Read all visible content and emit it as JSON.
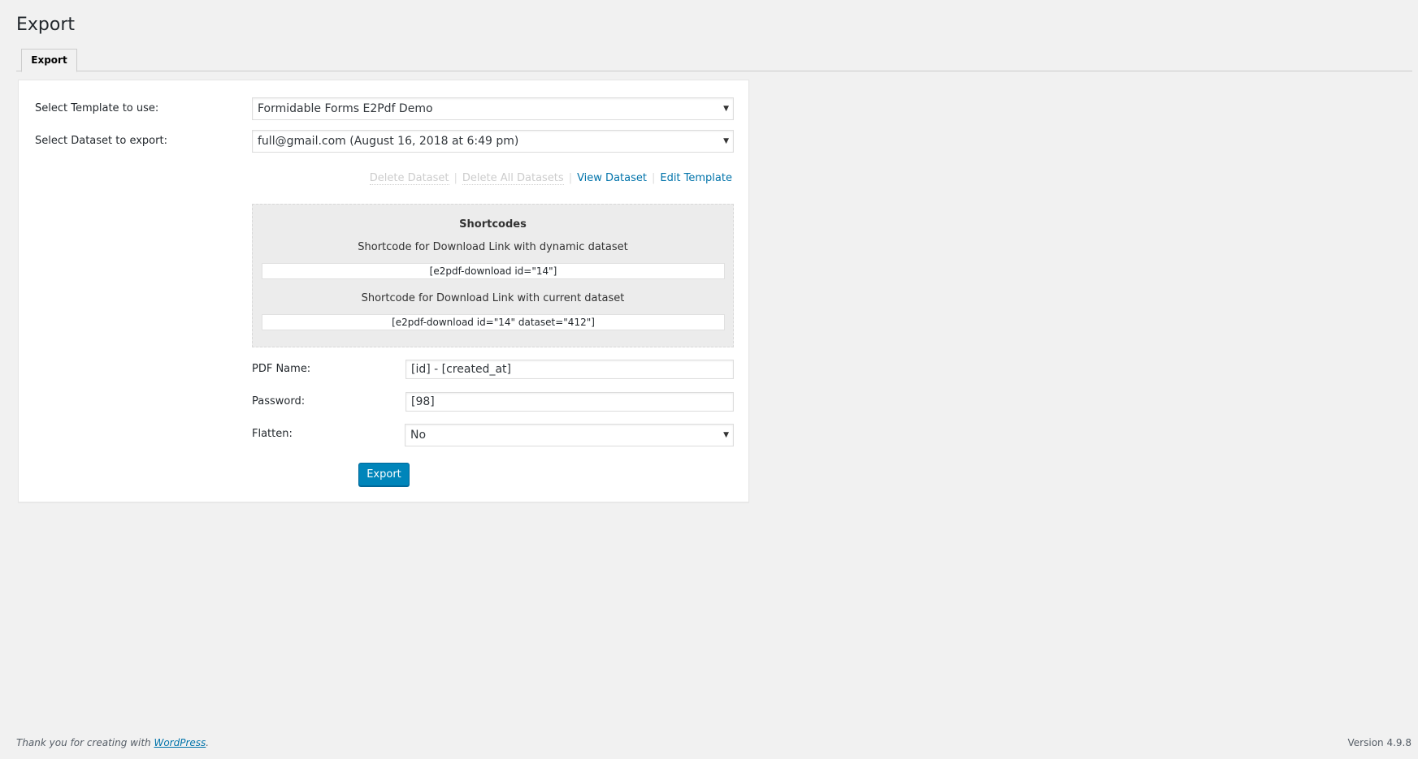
{
  "page": {
    "title": "Export"
  },
  "tabs": [
    {
      "label": "Export",
      "active": true
    }
  ],
  "form": {
    "template": {
      "label": "Select Template to use:",
      "value": "Formidable Forms E2Pdf Demo"
    },
    "dataset": {
      "label": "Select Dataset to export:",
      "value": "full@gmail.com (August 16, 2018 at 6:49 pm)"
    },
    "actions": {
      "delete_dataset": "Delete Dataset",
      "delete_all_datasets": "Delete All Datasets",
      "view_dataset": "View Dataset",
      "edit_template": "Edit Template",
      "separator": "|"
    },
    "shortcodes": {
      "title": "Shortcodes",
      "dynamic_label": "Shortcode for Download Link with dynamic dataset",
      "dynamic_value": "[e2pdf-download id=\"14\"]",
      "current_label": "Shortcode for Download Link with current dataset",
      "current_value": "[e2pdf-download id=\"14\" dataset=\"412\"]"
    },
    "pdf_name": {
      "label": "PDF Name:",
      "value": "[id] - [created_at]"
    },
    "password": {
      "label": "Password:",
      "value": "[98]"
    },
    "flatten": {
      "label": "Flatten:",
      "value": "No"
    },
    "export_button": "Export"
  },
  "footer": {
    "thanks_prefix": "Thank you for creating with ",
    "thanks_link": "WordPress",
    "thanks_suffix": ".",
    "version": "Version 4.9.8"
  },
  "icons": {
    "caret": "▼"
  },
  "colors": {
    "primary_button": "#0085ba",
    "link": "#0073aa",
    "disabled_link": "#cccccc",
    "background": "#f1f1f1"
  }
}
